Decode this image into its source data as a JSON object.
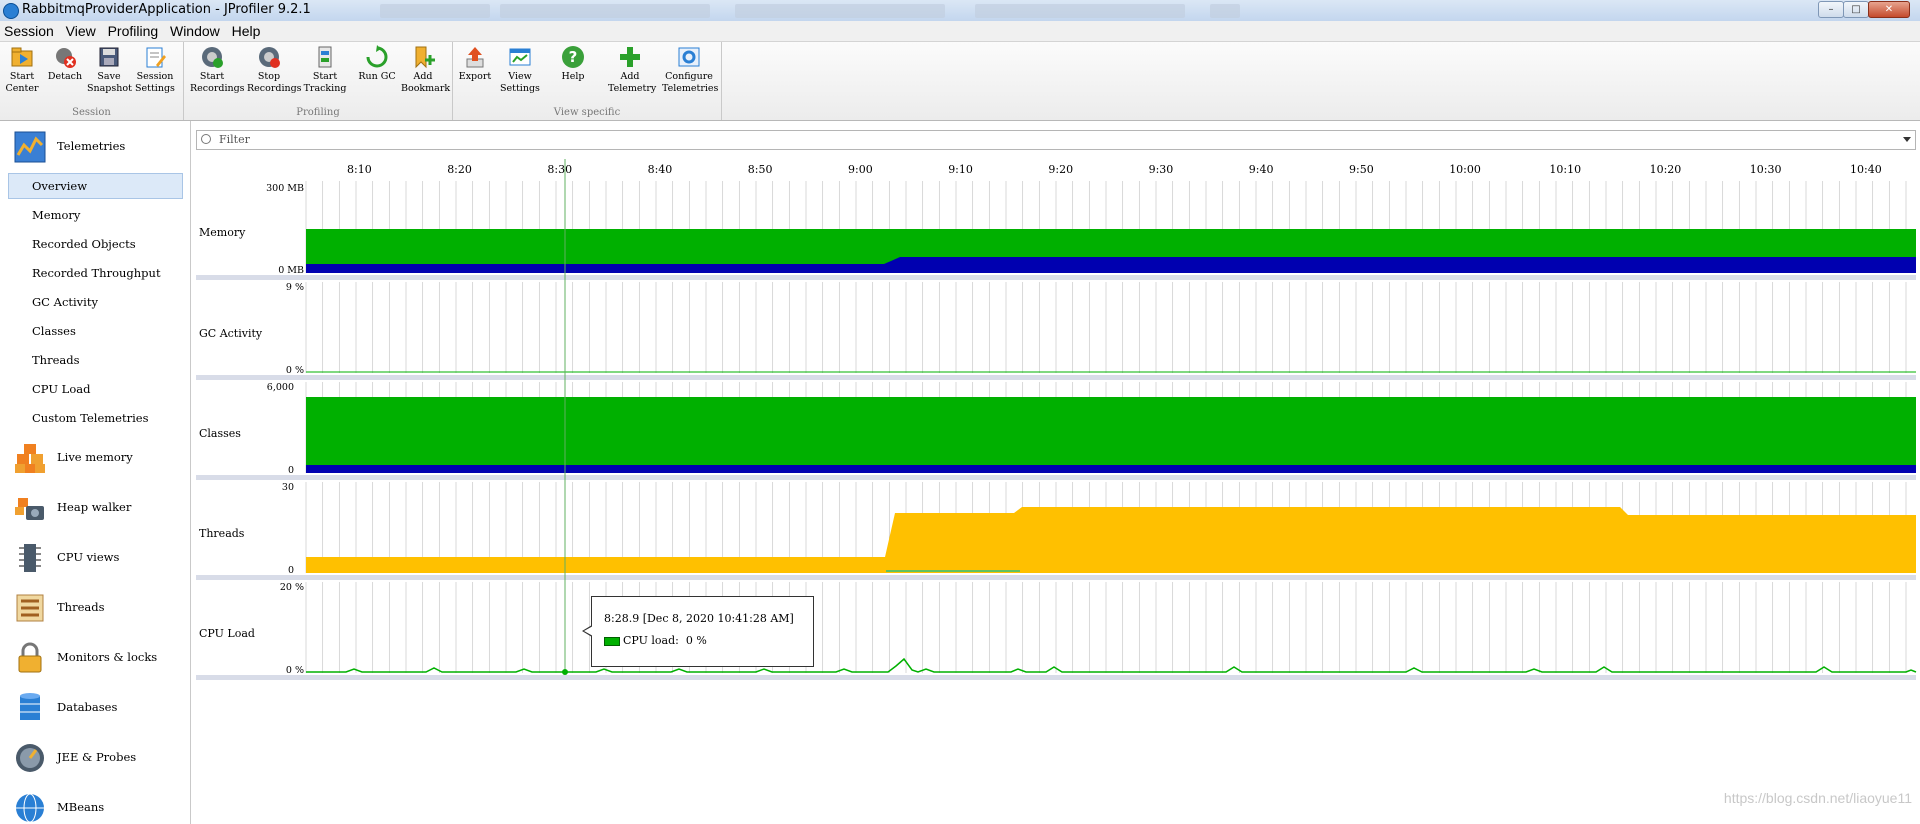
{
  "window": {
    "title": "RabbitmqProviderApplication - JProfiler 9.2.1"
  },
  "menu": [
    "Session",
    "View",
    "Profiling",
    "Window",
    "Help"
  ],
  "toolbar": {
    "groups": [
      {
        "label": "Session",
        "buttons": [
          {
            "label": "Start\nCenter",
            "icon": "start-center-icon"
          },
          {
            "label": "Detach",
            "icon": "detach-icon"
          },
          {
            "label": "Save\nSnapshot",
            "icon": "save-snapshot-icon"
          },
          {
            "label": "Session\nSettings",
            "icon": "session-settings-icon"
          }
        ]
      },
      {
        "label": "Profiling",
        "buttons": [
          {
            "label": "Start\nRecordings",
            "icon": "start-recordings-icon"
          },
          {
            "label": "Stop\nRecordings",
            "icon": "stop-recordings-icon"
          },
          {
            "label": "Start\nTracking",
            "icon": "start-tracking-icon"
          },
          {
            "label": "Run GC",
            "icon": "run-gc-icon"
          },
          {
            "label": "Add\nBookmark",
            "icon": "add-bookmark-icon"
          }
        ]
      },
      {
        "label": "View specific",
        "buttons": [
          {
            "label": "Export",
            "icon": "export-icon"
          },
          {
            "label": "View\nSettings",
            "icon": "view-settings-icon"
          },
          {
            "label": "Help",
            "icon": "help-icon"
          },
          {
            "label": "Add\nTelemetry",
            "icon": "add-telemetry-icon"
          },
          {
            "label": "Configure\nTelemetries",
            "icon": "configure-telemetries-icon"
          }
        ]
      }
    ]
  },
  "sidebar": {
    "telemetries": {
      "label": "Telemetries",
      "items": [
        "Overview",
        "Memory",
        "Recorded Objects",
        "Recorded Throughput",
        "GC Activity",
        "Classes",
        "Threads",
        "CPU Load",
        "Custom Telemetries"
      ],
      "selected": "Overview"
    },
    "sections": [
      {
        "label": "Live memory",
        "icon": "live-memory-icon"
      },
      {
        "label": "Heap walker",
        "icon": "heap-walker-icon"
      },
      {
        "label": "CPU views",
        "icon": "cpu-views-icon"
      },
      {
        "label": "Threads",
        "icon": "threads-icon"
      },
      {
        "label": "Monitors & locks",
        "icon": "monitors-locks-icon"
      },
      {
        "label": "Databases",
        "icon": "databases-icon"
      },
      {
        "label": "JEE & Probes",
        "icon": "jee-probes-icon"
      },
      {
        "label": "MBeans",
        "icon": "mbeans-icon"
      }
    ]
  },
  "filter": {
    "placeholder": "Filter"
  },
  "timeline": {
    "ticks": [
      "8:10",
      "8:20",
      "8:30",
      "8:40",
      "8:50",
      "9:00",
      "9:10",
      "9:20",
      "9:30",
      "9:40",
      "9:50",
      "10:00",
      "10:10",
      "10:20",
      "10:30",
      "10:40"
    ],
    "cursor": "8:28.9"
  },
  "telemetries": [
    {
      "name": "Memory",
      "ymax_label": "300 MB",
      "ymin_label": "0 MB"
    },
    {
      "name": "GC Activity",
      "ymax_label": "9 %",
      "ymin_label": "0 %"
    },
    {
      "name": "Classes",
      "ymax_label": "6,000",
      "ymin_label": "0"
    },
    {
      "name": "Threads",
      "ymax_label": "30",
      "ymin_label": "0"
    },
    {
      "name": "CPU Load",
      "ymax_label": "20 %",
      "ymin_label": "0 %"
    }
  ],
  "tooltip": {
    "time": "8:28.9 [Dec 8, 2020 10:41:28 AM]",
    "series": "CPU load:",
    "value": "0 %"
  },
  "colors": {
    "green": "#00b000",
    "blue": "#0000b0",
    "yellow": "#ffc000",
    "selection": "#dce9f8"
  },
  "watermark": "https://blog.csdn.net/liaoyue11"
}
